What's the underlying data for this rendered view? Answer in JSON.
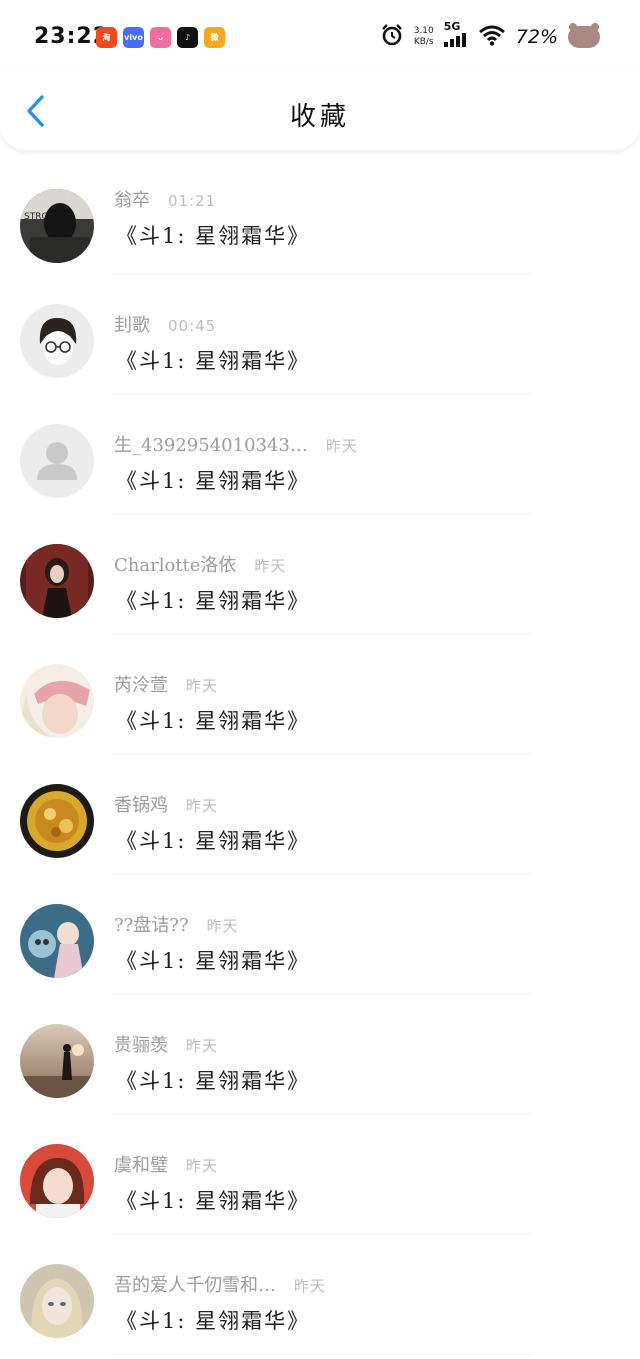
{
  "status_bar": {
    "time": "23:22",
    "net_speed_value": "3.10",
    "net_speed_unit": "KB/s",
    "network": "5G",
    "battery": "72%",
    "app_icons": [
      {
        "name": "taobao-icon",
        "color": "#f04a1e",
        "glyph": "淘"
      },
      {
        "name": "vivo-icon",
        "color": "#4a6cf7",
        "glyph": "vivo"
      },
      {
        "name": "bilibili-icon",
        "color": "#f36ea0",
        "glyph": "ᴗ"
      },
      {
        "name": "tiktok-icon",
        "color": "#111111",
        "glyph": "♪"
      },
      {
        "name": "weibo-icon",
        "color": "#f5a623",
        "glyph": "微"
      }
    ]
  },
  "header": {
    "title": "收藏"
  },
  "colors": {
    "accent": "#2f8ee8",
    "name_text": "#9c9c9c",
    "time_text": "#bdbdbd"
  },
  "items": [
    {
      "name": "翁卒",
      "time": "01:21",
      "title": "《斗1: 星翎霜华》",
      "avatar": "photo-dark"
    },
    {
      "name": "刲歌",
      "time": "00:45",
      "title": "《斗1: 星翎霜华》",
      "avatar": "cartoon-glasses"
    },
    {
      "name": "生_4392954010343…",
      "time": "昨天",
      "title": "《斗1: 星翎霜华》",
      "avatar": "default-user"
    },
    {
      "name": "Charlotte洛依",
      "time": "昨天",
      "title": "《斗1: 星翎霜华》",
      "avatar": "photo-red"
    },
    {
      "name": "芮泠萱",
      "time": "昨天",
      "title": "《斗1: 星翎霜华》",
      "avatar": "photo-pink"
    },
    {
      "name": "香锅鸡",
      "time": "昨天",
      "title": "《斗1: 星翎霜华》",
      "avatar": "photo-food"
    },
    {
      "name": "??盘诘??",
      "time": "昨天",
      "title": "《斗1: 星翎霜华》",
      "avatar": "photo-blue"
    },
    {
      "name": "贵骊羡",
      "time": "昨天",
      "title": "《斗1: 星翎霜华》",
      "avatar": "photo-sunset"
    },
    {
      "name": "虞和璧",
      "time": "昨天",
      "title": "《斗1: 星翎霜华》",
      "avatar": "photo-girl-red"
    },
    {
      "name": "吾的爱人千仞雪和…",
      "time": "昨天",
      "title": "《斗1: 星翎霜华》",
      "avatar": "photo-doll"
    }
  ]
}
